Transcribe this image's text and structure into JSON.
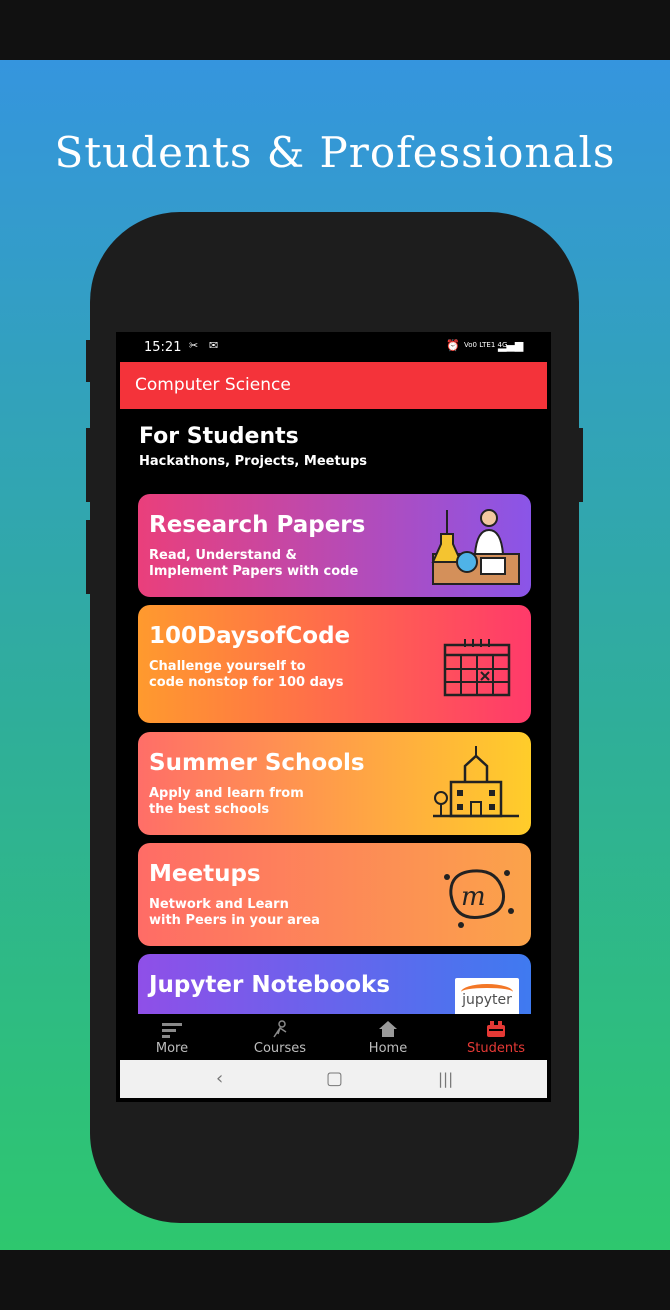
{
  "banner": {
    "headline": "Students & Professionals"
  },
  "status_bar": {
    "time": "15:21",
    "network": "Vo0 LTE1 4G"
  },
  "app_bar": {
    "title": "Computer Science"
  },
  "section": {
    "title": "For Students",
    "subtitle": "Hackathons, Projects, Meetups"
  },
  "cards": [
    {
      "title": "Research Papers",
      "line1": "Read, Understand &",
      "line2": "Implement Papers with code",
      "icon": "scientist-lab-icon"
    },
    {
      "title": "100DaysofCode",
      "line1": "Challenge yourself to",
      "line2": "code nonstop for 100 days",
      "icon": "calendar-icon"
    },
    {
      "title": "Summer Schools",
      "line1": "Apply and learn from",
      "line2": "the best schools",
      "icon": "school-building-icon"
    },
    {
      "title": "Meetups",
      "line1": "Network and Learn",
      "line2": "with Peers in your area",
      "icon": "meetup-logo-icon"
    },
    {
      "title": "Jupyter Notebooks",
      "line1": "",
      "line2": "",
      "icon": "jupyter-logo-icon",
      "logo_text": "jupyter"
    }
  ],
  "bottom_nav": [
    {
      "label": "More",
      "icon": "menu-lines-icon",
      "active": false
    },
    {
      "label": "Courses",
      "icon": "courses-icon",
      "active": false
    },
    {
      "label": "Home",
      "icon": "home-icon",
      "active": false
    },
    {
      "label": "Students",
      "icon": "students-icon",
      "active": true
    }
  ],
  "colors": {
    "accent": "#f4333a",
    "active_nav": "#e53935"
  }
}
